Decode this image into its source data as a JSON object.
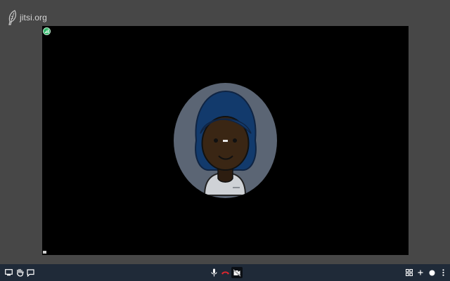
{
  "branding": {
    "logo_text": "jitsi.org",
    "logo_icon": "jitsi-leaf-icon"
  },
  "stage": {
    "connection_indicator": {
      "icon": "connection-quality-icon",
      "status": "good",
      "color": "#31b76a"
    },
    "participant": {
      "avatar_icon": "default-avatar-icon"
    }
  },
  "toolbar": {
    "left": [
      {
        "icon": "screen-share-icon"
      },
      {
        "icon": "raise-hand-icon"
      },
      {
        "icon": "chat-icon"
      }
    ],
    "center": [
      {
        "icon": "microphone-icon"
      },
      {
        "icon": "hangup-icon",
        "color": "#e0262e"
      },
      {
        "icon": "camera-muted-icon",
        "active": true
      }
    ],
    "right": [
      {
        "icon": "tile-view-icon"
      },
      {
        "icon": "invite-icon"
      },
      {
        "icon": "info-icon"
      },
      {
        "icon": "more-options-icon"
      }
    ]
  }
}
